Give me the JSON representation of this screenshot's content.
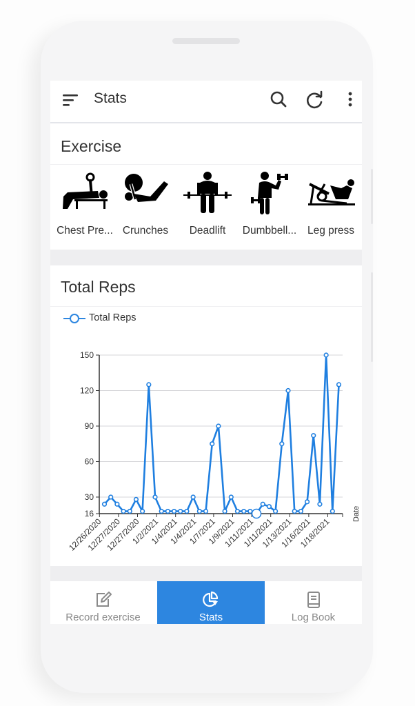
{
  "appbar": {
    "title": "Stats",
    "icons": [
      "menu-icon",
      "search-icon",
      "refresh-icon",
      "more-vert-icon"
    ]
  },
  "exercise": {
    "title": "Exercise",
    "items": [
      {
        "label": "Chest Pre...",
        "icon": "chest-press-icon"
      },
      {
        "label": "Crunches",
        "icon": "crunches-icon"
      },
      {
        "label": "Deadlift",
        "icon": "deadlift-icon"
      },
      {
        "label": "Dumbbell...",
        "icon": "dumbbell-icon"
      },
      {
        "label": "Leg press",
        "icon": "leg-press-icon"
      }
    ]
  },
  "reps": {
    "title": "Total Reps"
  },
  "colors": {
    "accent": "#2d86e0",
    "line": "#1f7fe0",
    "grid": "#d4d4d8"
  },
  "chart_data": {
    "type": "line",
    "title": "Total Reps",
    "xlabel": "Date",
    "ylabel": "",
    "legend": [
      "Total Reps"
    ],
    "legend_position": "top-left",
    "grid": true,
    "ylim": [
      16,
      150
    ],
    "yticks": [
      16,
      30,
      60,
      90,
      120,
      150
    ],
    "xtick_labels": [
      "12/26/2020",
      "12/27/2020",
      "12/27/2020",
      "1/2/2021",
      "1/4/2021",
      "1/4/2021",
      "1/7/2021",
      "1/9/2021",
      "1/11/2021",
      "1/11/2021",
      "1/13/2021",
      "1/16/2021",
      "1/18/2021"
    ],
    "series": [
      {
        "name": "Total Reps",
        "values": [
          24,
          30,
          24,
          18,
          18,
          28,
          18,
          125,
          30,
          18,
          18,
          18,
          18,
          18,
          30,
          18,
          18,
          75,
          90,
          18,
          30,
          18,
          18,
          18,
          16,
          24,
          22,
          18,
          75,
          120,
          18,
          18,
          26,
          82,
          24,
          150,
          18,
          125
        ],
        "highlighted_index": 24
      }
    ]
  },
  "bottomnav": {
    "tabs": [
      {
        "label": "Record exercise",
        "icon": "edit-icon",
        "active": false
      },
      {
        "label": "Stats",
        "icon": "pie-chart-icon",
        "active": true
      },
      {
        "label": "Log Book",
        "icon": "book-icon",
        "active": false
      }
    ]
  }
}
